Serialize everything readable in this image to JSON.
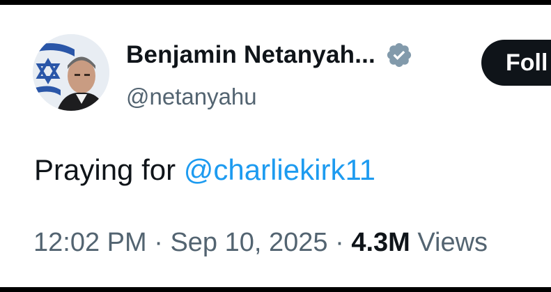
{
  "author": {
    "display_name": "Benjamin Netanyah...",
    "handle": "@netanyahu",
    "verified_icon": "verified-badge-icon",
    "verified_color": "#829aab"
  },
  "follow_button": {
    "label": "Foll"
  },
  "tweet": {
    "text_prefix": "Praying for ",
    "mention": "@charliekirk11"
  },
  "meta": {
    "time": "12:02 PM",
    "separator": " · ",
    "date": "Sep 10, 2025",
    "separator2": " · ",
    "views_count": "4.3M",
    "views_label": " Views"
  },
  "colors": {
    "text_primary": "#0f1419",
    "text_secondary": "#536471",
    "link": "#1d9bf0",
    "button_bg": "#0f1419"
  }
}
